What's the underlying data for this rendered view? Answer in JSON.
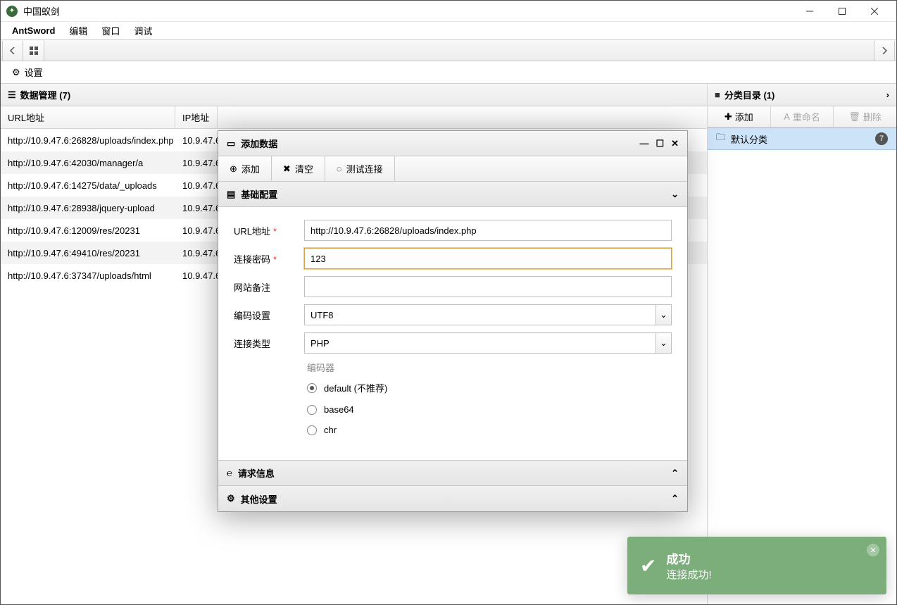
{
  "window": {
    "title": "中国蚁剑"
  },
  "menubar": {
    "items": [
      "AntSword",
      "编辑",
      "窗口",
      "调试"
    ]
  },
  "tab": {
    "label": "设置"
  },
  "dataPanel": {
    "title": "数据管理 (7)",
    "columns": {
      "url": "URL地址",
      "ip": "IP地址"
    },
    "rows": [
      {
        "url": "http://10.9.47.6:26828/uploads/index.php",
        "ip": "10.9.47.6"
      },
      {
        "url": "http://10.9.47.6:42030/manager/a",
        "ip": "10.9.47.6"
      },
      {
        "url": "http://10.9.47.6:14275/data/_uploads",
        "ip": "10.9.47.6"
      },
      {
        "url": "http://10.9.47.6:28938/jquery-upload",
        "ip": "10.9.47.6"
      },
      {
        "url": "http://10.9.47.6:12009/res/20231",
        "ip": "10.9.47.6"
      },
      {
        "url": "http://10.9.47.6:49410/res/20231",
        "ip": "10.9.47.6"
      },
      {
        "url": "http://10.9.47.6:37347/uploads/html",
        "ip": "10.9.47.6"
      }
    ]
  },
  "categoryPanel": {
    "title": "分类目录 (1)",
    "buttons": {
      "add": "添加",
      "rename": "重命名",
      "delete": "删除"
    },
    "item": {
      "label": "默认分类",
      "count": "7"
    }
  },
  "dialog": {
    "title": "添加数据",
    "toolbar": {
      "add": "添加",
      "clear": "清空",
      "test": "测试连接"
    },
    "section_basic": "基础配置",
    "section_request": "请求信息",
    "section_other": "其他设置",
    "labels": {
      "url": "URL地址",
      "password": "连接密码",
      "note": "网站备注",
      "encoding": "编码设置",
      "conntype": "连接类型",
      "encoder": "编码器"
    },
    "values": {
      "url": "http://10.9.47.6:26828/uploads/index.php",
      "password": "123",
      "note": "",
      "encoding": "UTF8",
      "conntype": "PHP"
    },
    "encoders": {
      "default": "default (不推荐)",
      "base64": "base64",
      "chr": "chr"
    }
  },
  "toast": {
    "title": "成功",
    "message": "连接成功!"
  }
}
